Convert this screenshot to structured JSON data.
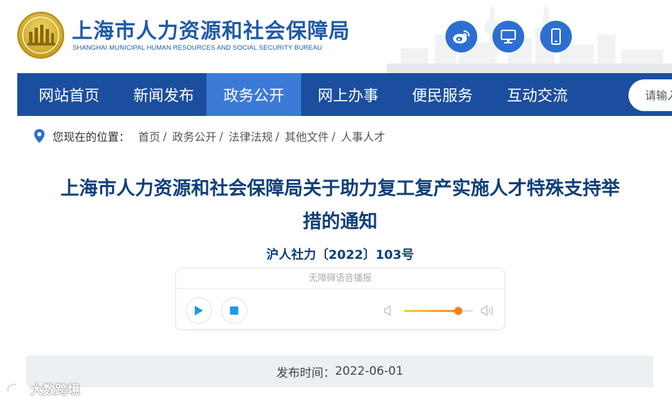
{
  "header": {
    "title": "上海市人力资源和社会保障局",
    "subtitle": "SHANGHAI MUNICIPAL HUMAN RESOURCES AND SOCIAL SECURITY BUREAU",
    "icons": [
      "weibo-icon",
      "desktop-icon",
      "mobile-icon"
    ]
  },
  "nav": {
    "items": [
      "网站首页",
      "新闻发布",
      "政务公开",
      "网上办事",
      "便民服务",
      "互动交流"
    ],
    "active": "政务公开",
    "search_placeholder": "请输入"
  },
  "breadcrumb": {
    "label": "您现在的位置：",
    "items": [
      "首页",
      "政务公开",
      "法律法规",
      "其他文件",
      "人事人才"
    ]
  },
  "article": {
    "title_line1": "上海市人力资源和社会保障局关于助力复工复产实施人才特殊支持举",
    "title_line2": "措的通知",
    "doc_number": "沪人社力〔2022〕103号"
  },
  "player": {
    "label": "无障碍语音播报",
    "volume_fraction": 0.78
  },
  "publish": {
    "label": "发布时间：",
    "date": "2022-06-01"
  },
  "watermark": {
    "text": "大数跨境"
  },
  "colors": {
    "nav_bg": "#1b4e9e",
    "nav_active": "#3b7ad6",
    "title_blue": "#0f3f7a",
    "brand_blue": "#1d5aa8",
    "icon_circle": "#2d6fd0"
  }
}
